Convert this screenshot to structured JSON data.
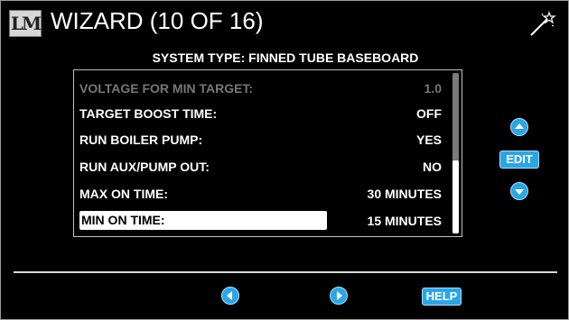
{
  "header": {
    "logo_text": "LM",
    "title": "WIZARD (10 OF 16)",
    "wand_icon": "magic-wand-icon"
  },
  "subtitle": "SYSTEM TYPE: FINNED TUBE BASEBOARD",
  "list": {
    "rows": [
      {
        "label": "VOLTAGE FOR MIN TARGET:",
        "value": "1.0",
        "state": "disabled"
      },
      {
        "label": "TARGET BOOST TIME:",
        "value": "OFF",
        "state": "normal"
      },
      {
        "label": "RUN BOILER PUMP:",
        "value": "YES",
        "state": "normal"
      },
      {
        "label": "RUN AUX/PUMP OUT:",
        "value": "NO",
        "state": "normal"
      },
      {
        "label": "MAX ON TIME:",
        "value": "30 MINUTES",
        "state": "normal"
      },
      {
        "label": "MIN ON TIME:",
        "value": "15 MINUTES",
        "state": "selected"
      }
    ]
  },
  "side_controls": {
    "up_icon": "chevron-up-icon",
    "edit_label": "EDIT",
    "down_icon": "chevron-down-icon"
  },
  "footer": {
    "back_icon": "chevron-left-icon",
    "next_icon": "chevron-right-icon",
    "help_label": "HELP"
  },
  "colors": {
    "background": "#000000",
    "accent": "#2aa6e6",
    "text": "#ffffff",
    "disabled_text": "#777777"
  }
}
